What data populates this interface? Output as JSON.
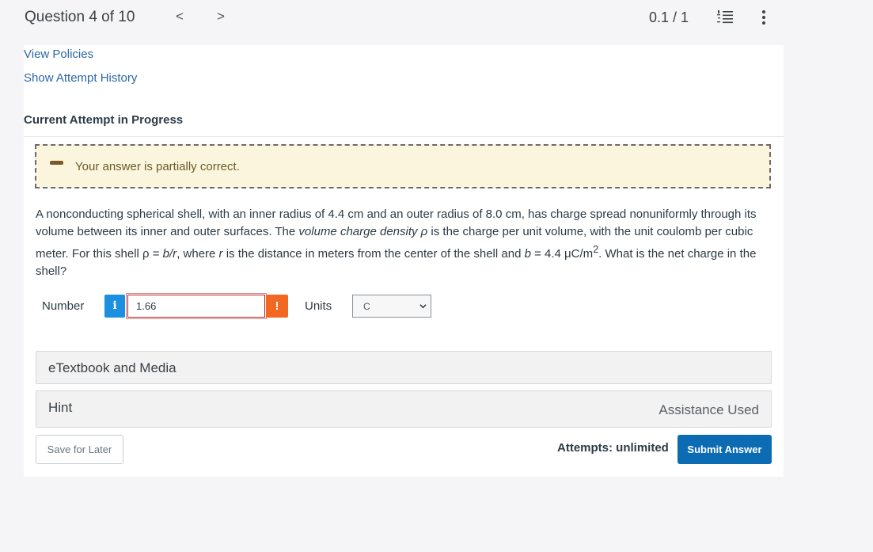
{
  "header": {
    "question_counter": "Question 4 of 10",
    "prev_arrow": "<",
    "next_arrow": ">",
    "score": "0.1 / 1",
    "icons": [
      "list-icon",
      "more-vertical-icon"
    ]
  },
  "links": {
    "view_policies": "View Policies",
    "show_history": "Show Attempt History"
  },
  "attempt_title": "Current Attempt in Progress",
  "feedback": {
    "text": "Your answer is partially correct.",
    "color": "#fbf5dd"
  },
  "question": {
    "p1": "A nonconducting spherical shell, with an inner radius of 4.4 cm and an outer radius of 8.0 cm, has charge spread nonuniformly through its volume between its inner and outer surfaces. The ",
    "em1": "volume charge density ρ",
    "p2": " is the charge per unit volume, with the unit coulomb per cubic meter. For this shell ρ = ",
    "em2": "b/r",
    "p3": ", where ",
    "em3": "r",
    "p4": " is the distance in meters from the center of the shell and ",
    "em4": "b",
    "p5": " = 4.4 μC/m",
    "sup": "2",
    "p6": ". What is the net charge in the shell?"
  },
  "answer": {
    "number_label": "Number",
    "info_glyph": "i",
    "number_value": "1.66",
    "warning_glyph": "!",
    "units_label": "Units",
    "units_value": "C"
  },
  "accordions": {
    "textbook": "eTextbook and Media",
    "hint": "Hint",
    "assistance": "Assistance Used"
  },
  "footer": {
    "save_label": "Save for Later",
    "attempts_text": "Attempts: unlimited",
    "submit_label": "Submit Answer"
  },
  "colors": {
    "link": "#2a68a8",
    "info": "#1b8fe0",
    "warning": "#f26722",
    "submit": "#0c6cb3"
  }
}
